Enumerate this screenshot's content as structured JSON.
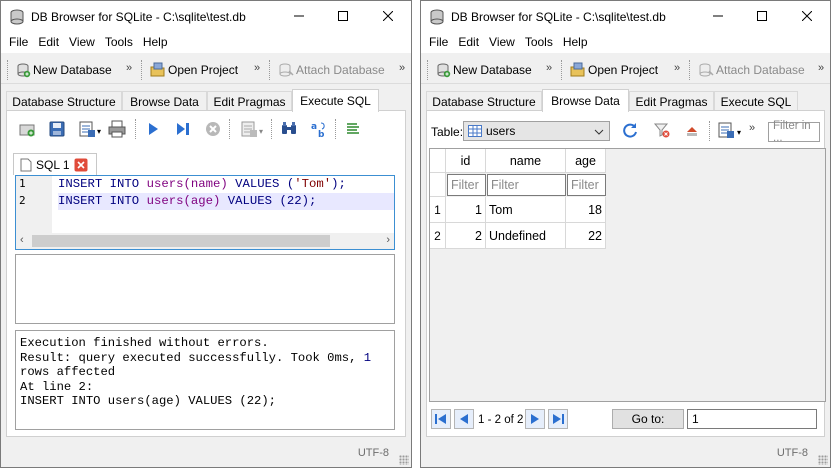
{
  "window_left": {
    "title": "DB Browser for SQLite - C:\\sqlite\\test.db",
    "menu": [
      "File",
      "Edit",
      "View",
      "Tools",
      "Help"
    ],
    "toolbar": {
      "new_db": "New Database",
      "open_project": "Open Project",
      "attach_db": "Attach Database",
      "more": "»"
    },
    "tabs": [
      "Database Structure",
      "Browse Data",
      "Edit Pragmas",
      "Execute SQL"
    ],
    "active_tab": "Execute SQL",
    "sql_tab_label": "SQL 1",
    "editor": {
      "line_numbers": [
        "1",
        "2"
      ],
      "line1": {
        "kw1": "INSERT INTO",
        "tbl": "users",
        "cols": "(name)",
        "kw2": "VALUES",
        "open": " (",
        "str": "'Tom'",
        "close": ");"
      },
      "line2": {
        "kw1": "INSERT INTO",
        "tbl": "users",
        "cols": "(age)",
        "kw2": "VALUES",
        "open": " (",
        "num": "22",
        "close": ");"
      }
    },
    "messages": {
      "line1": "Execution finished without errors.",
      "line2a": "Result: query executed successfully. Took 0ms, ",
      "line2b": "1",
      "line3": "rows affected",
      "line4": "At line 2:",
      "line5": "INSERT INTO users(age) VALUES (22);"
    },
    "status_encoding": "UTF-8"
  },
  "window_right": {
    "title": "DB Browser for SQLite - C:\\sqlite\\test.db",
    "menu": [
      "File",
      "Edit",
      "View",
      "Tools",
      "Help"
    ],
    "toolbar": {
      "new_db": "New Database",
      "open_project": "Open Project",
      "attach_db": "Attach Database",
      "more": "»"
    },
    "tabs": [
      "Database Structure",
      "Browse Data",
      "Edit Pragmas",
      "Execute SQL"
    ],
    "active_tab": "Browse Data",
    "table_label": "Table:",
    "table_name": "users",
    "filter_placeholder": "Filter in ...",
    "columns": [
      "id",
      "name",
      "age"
    ],
    "filter_cells": [
      "Filter",
      "Filter",
      "Filter"
    ],
    "rows": [
      {
        "row_num": "1",
        "id": "1",
        "name": "Tom",
        "age": "18"
      },
      {
        "row_num": "2",
        "id": "2",
        "name": "Undefined",
        "age": "22"
      }
    ],
    "paging": "1 - 2 of 2",
    "goto_label": "Go to:",
    "goto_value": "1",
    "status_encoding": "UTF-8"
  },
  "colors": {
    "accent": "#3c8fd2",
    "keyword": "#00007f",
    "table": "#7f007f",
    "string": "#7f0000",
    "tab_close": "#e04b3a"
  }
}
